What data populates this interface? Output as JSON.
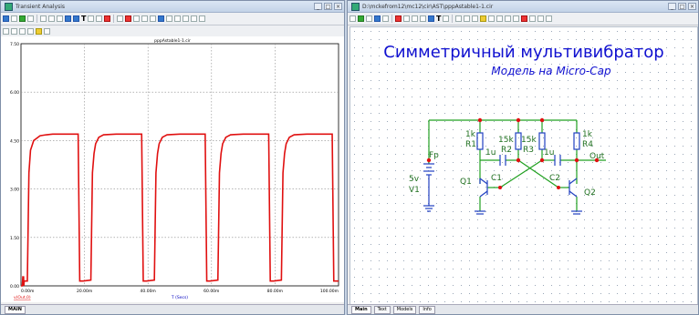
{
  "left_window": {
    "title": "Transient Analysis",
    "plot_title": "pppAstable1-1.cir",
    "x_axis_label": "T (Secs)",
    "x_ticks": [
      "0.00m",
      "20.00m",
      "40.00m",
      "60.00m",
      "80.00m",
      "100.00m"
    ],
    "y_ticks": [
      "7.50",
      "6.00",
      "4.50",
      "3.00",
      "1.50",
      "0.00"
    ],
    "trace_label": "v(Out,0)",
    "tab_main": "MAIN"
  },
  "right_window": {
    "title": "D:\\mckefrom12\\mc12\\cir\\AST\\pppAstable1-1.cir",
    "heading": "Симметричный мультивибратор",
    "subheading": "Модель на Micro-Cap",
    "tabs": [
      "Main",
      "Text",
      "Models",
      "Info"
    ]
  },
  "schematic": {
    "labels": {
      "fp": "Fp",
      "v1": "V1",
      "v1_value": "5v",
      "r1": "R1",
      "r1_value": "1k",
      "r2": "R2",
      "r2_value": "15k",
      "r3": "R3",
      "r3_value": "15k",
      "r4": "R4",
      "r4_value": "1k",
      "c1": "C1",
      "c1_value": "1u",
      "c2": "C2",
      "c2_value": "1u",
      "q1": "Q1",
      "q2": "Q2",
      "out": "Out"
    }
  },
  "chart_data": {
    "type": "line",
    "title": "pppAstable1-1.cir",
    "xlabel": "T (Secs)",
    "ylabel": "",
    "xlim": [
      0,
      0.1
    ],
    "ylim": [
      0,
      7.5
    ],
    "x_tick_labels": [
      "0.00m",
      "20.00m",
      "40.00m",
      "60.00m",
      "80.00m",
      "100.00m"
    ],
    "y_tick_labels": [
      "7.50",
      "6.00",
      "4.50",
      "3.00",
      "1.50",
      "0.00"
    ],
    "grid": true,
    "series": [
      {
        "name": "v(Out,0)",
        "color": "#e01010",
        "x": [
          0.0,
          0.0004,
          0.0006,
          0.0007,
          0.0008,
          0.0009,
          0.001,
          0.002,
          0.0025,
          0.003,
          0.004,
          0.006,
          0.008,
          0.01,
          0.0115,
          0.0145,
          0.018,
          0.0185,
          0.0195,
          0.022,
          0.0225,
          0.023,
          0.0235,
          0.0245,
          0.026,
          0.03,
          0.035,
          0.038,
          0.0385,
          0.0395,
          0.042,
          0.0425,
          0.043,
          0.0435,
          0.0445,
          0.046,
          0.05,
          0.055,
          0.058,
          0.0585,
          0.0595,
          0.062,
          0.0625,
          0.063,
          0.0635,
          0.0645,
          0.066,
          0.07,
          0.075,
          0.078,
          0.0785,
          0.0795,
          0.082,
          0.0825,
          0.083,
          0.0835,
          0.0845,
          0.086,
          0.09,
          0.095,
          0.098,
          0.0985,
          0.0995,
          0.1
        ],
        "y": [
          0.0,
          0.0,
          0.3,
          0.0,
          0.3,
          0.0,
          0.15,
          0.15,
          3.5,
          4.2,
          4.5,
          4.65,
          4.68,
          4.7,
          4.7,
          4.7,
          4.7,
          0.15,
          0.15,
          0.18,
          3.5,
          4.1,
          4.4,
          4.6,
          4.68,
          4.7,
          4.7,
          4.7,
          0.15,
          0.15,
          0.18,
          3.5,
          4.1,
          4.4,
          4.6,
          4.68,
          4.7,
          4.7,
          4.7,
          0.15,
          0.15,
          0.18,
          3.5,
          4.1,
          4.4,
          4.6,
          4.68,
          4.7,
          4.7,
          4.7,
          0.15,
          0.15,
          0.18,
          3.5,
          4.1,
          4.4,
          4.6,
          4.68,
          4.7,
          4.7,
          4.7,
          0.15,
          0.15,
          0.15
        ]
      }
    ]
  }
}
